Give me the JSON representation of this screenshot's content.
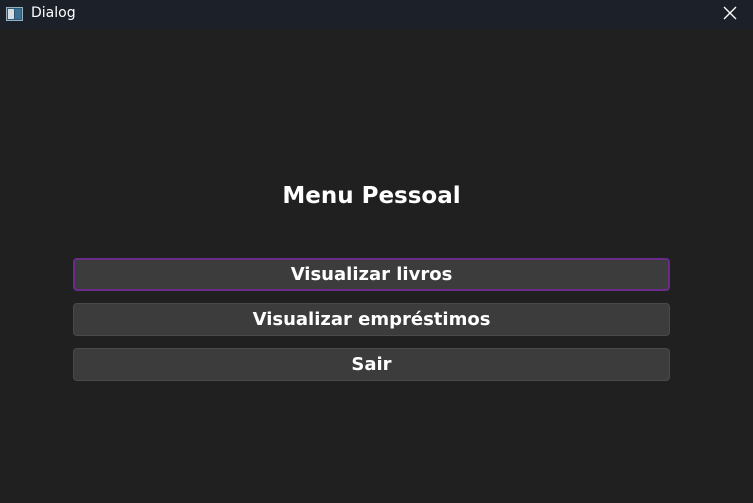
{
  "window": {
    "title": "Dialog"
  },
  "page": {
    "heading": "Menu Pessoal"
  },
  "buttons": {
    "view_books": "Visualizar livros",
    "view_loans": "Visualizar empréstimos",
    "exit": "Sair"
  },
  "colors": {
    "background": "#202020",
    "titlebar": "#1c2028",
    "button_bg": "#3c3c3c",
    "focus_border": "#6a2a8a"
  }
}
